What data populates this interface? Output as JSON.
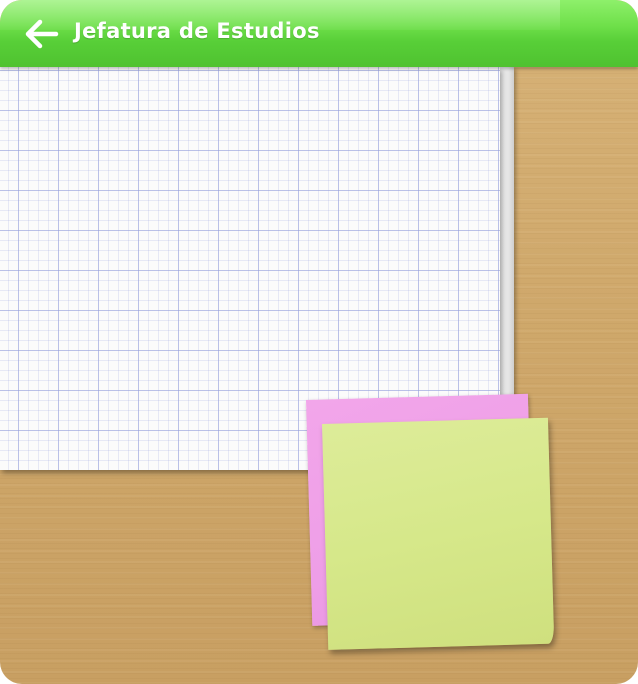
{
  "header": {
    "title": "Jefatura de Estudios",
    "back_icon": "arrow-left-icon",
    "accent": "#5fd63e"
  },
  "board": {
    "background": "#cfa86b"
  },
  "sticky_notes": [
    {
      "color": "#ee9ee7"
    },
    {
      "color": "#d6e88a"
    }
  ]
}
